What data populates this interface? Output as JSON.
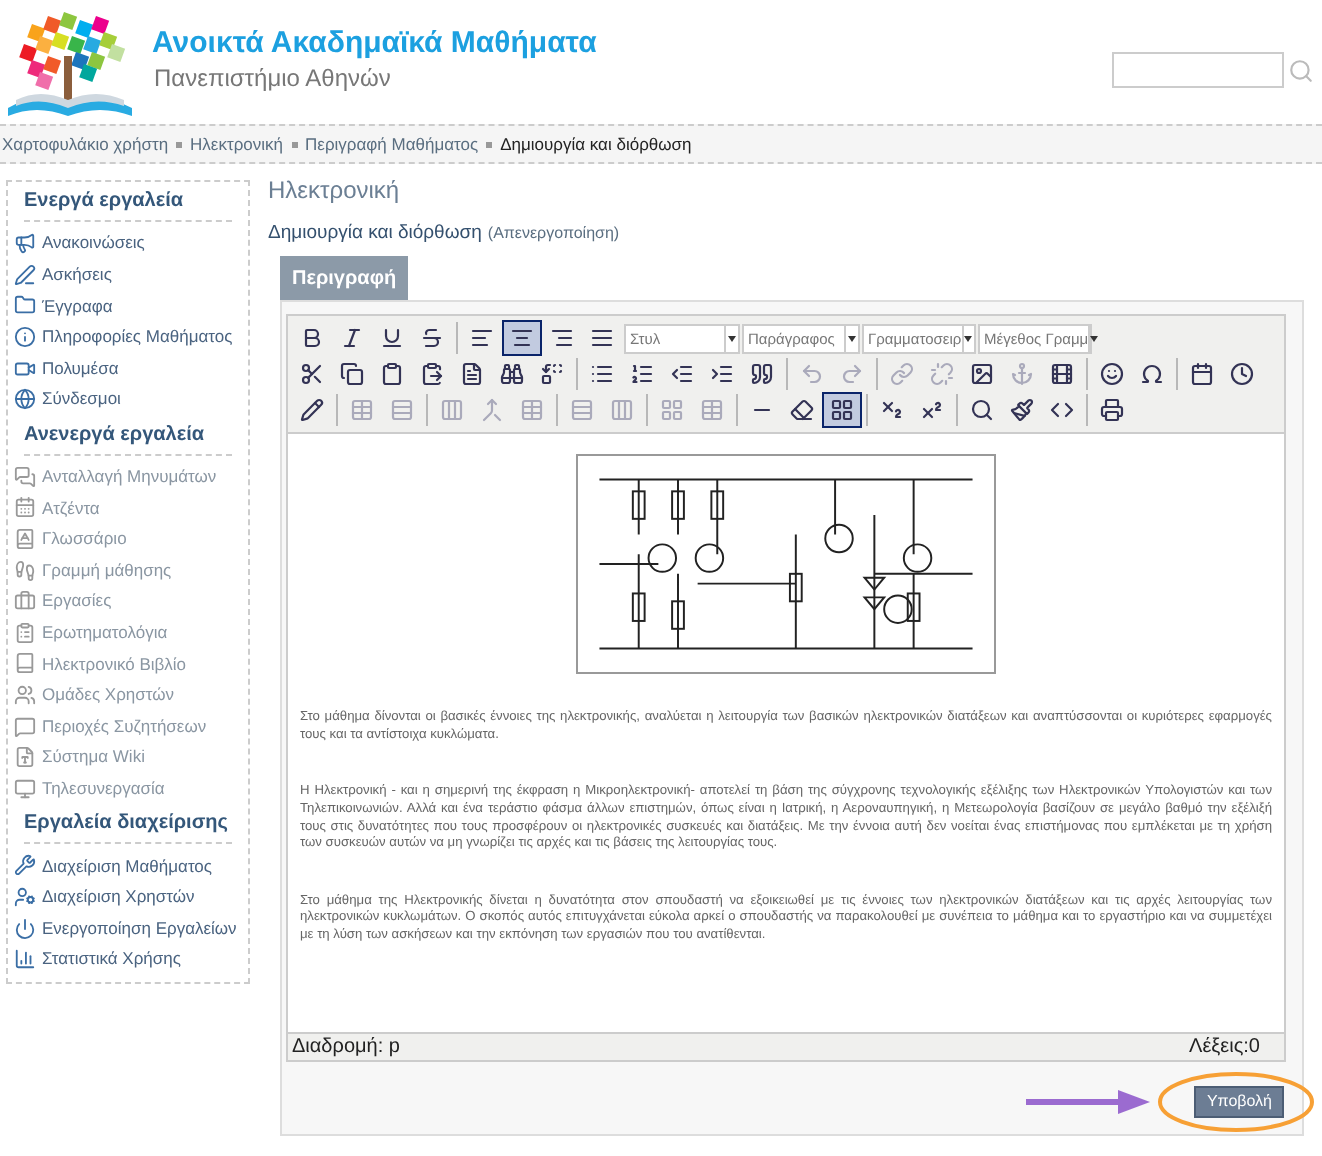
{
  "header": {
    "title": "Ανοικτά Ακαδημαϊκά Μαθήματα",
    "subtitle": "Πανεπιστήμιο Αθηνών"
  },
  "breadcrumb": [
    {
      "label": "Χαρτοφυλάκιο χρήστη",
      "current": false
    },
    {
      "label": "Ηλεκτρονική",
      "current": false
    },
    {
      "label": "Περιγραφή Μαθήματος",
      "current": false
    },
    {
      "label": "Δημιουργία και διόρθωση",
      "current": true
    }
  ],
  "sidebar": [
    {
      "title": "Ενεργά εργαλεία",
      "items": [
        {
          "label": "Ανακοινώσεις",
          "disabled": false
        },
        {
          "label": "Ασκήσεις",
          "disabled": false
        },
        {
          "label": "Έγγραφα",
          "disabled": false
        },
        {
          "label": "Πληροφορίες Μαθήματος",
          "disabled": false
        },
        {
          "label": "Πολυμέσα",
          "disabled": false
        },
        {
          "label": "Σύνδεσμοι",
          "disabled": false
        }
      ]
    },
    {
      "title": "Ανενεργά εργαλεία",
      "items": [
        {
          "label": "Ανταλλαγή Μηνυμάτων",
          "disabled": true
        },
        {
          "label": "Ατζέντα",
          "disabled": true
        },
        {
          "label": "Γλωσσάριο",
          "disabled": true
        },
        {
          "label": "Γραμμή μάθησης",
          "disabled": true
        },
        {
          "label": "Εργασίες",
          "disabled": true
        },
        {
          "label": "Ερωτηματολόγια",
          "disabled": true
        },
        {
          "label": "Ηλεκτρονικό Βιβλίο",
          "disabled": true
        },
        {
          "label": "Ομάδες Χρηστών",
          "disabled": true
        },
        {
          "label": "Περιοχές Συζητήσεων",
          "disabled": true
        },
        {
          "label": "Σύστημα Wiki",
          "disabled": true
        },
        {
          "label": "Τηλεσυνεργασία",
          "disabled": true
        }
      ]
    },
    {
      "title": "Εργαλεία διαχείρισης",
      "items": [
        {
          "label": "Διαχείριση Μαθήματος",
          "disabled": false
        },
        {
          "label": "Διαχείριση Χρηστών",
          "disabled": false
        },
        {
          "label": "Ενεργοποίηση Εργαλείων",
          "disabled": false
        },
        {
          "label": "Στατιστικά Χρήσης",
          "disabled": false
        }
      ]
    }
  ],
  "page_title": "Ηλεκτρονική",
  "subtitle": {
    "text": "Δημιουργία και διόρθωση",
    "link": "(Απενεργοποίηση)"
  },
  "tab": {
    "label": "Περιγραφή",
    "selected": true
  },
  "toolbar": {
    "row1_buttons": [
      {
        "selected": false
      },
      {
        "selected": false
      },
      {
        "selected": false
      },
      {
        "selected": false
      },
      {
        "selected": false
      },
      {
        "selected": true
      },
      {
        "selected": false
      },
      {
        "selected": false
      }
    ],
    "dropdowns": [
      {
        "value": "Στυλ"
      },
      {
        "value": "Παράγραφος"
      },
      {
        "value": "Γραμματοσειρ"
      },
      {
        "value": "Μέγεθος Γραμμ"
      }
    ],
    "row3_buttons": [
      {
        "selected": false
      },
      {
        "selected": false
      },
      {
        "selected": false
      },
      {
        "selected": false
      },
      {
        "selected": false
      },
      {
        "selected": false
      },
      {
        "selected": false
      },
      {
        "selected": false
      },
      {
        "selected": false
      },
      {
        "selected": false
      },
      {
        "selected": false
      },
      {
        "selected": false
      },
      {
        "selected": true
      },
      {
        "selected": false
      },
      {
        "selected": false
      },
      {
        "selected": false
      },
      {
        "selected": false
      },
      {
        "selected": false
      },
      {
        "selected": false
      }
    ]
  },
  "content": {
    "paragraphs": [
      "Στο μάθημα δίνονται οι βασικές έννοιες της ηλεκτρονικής, αναλύεται η λειτουργία των βασικών ηλεκτρονικών διατάξεων και αναπτύσσονται οι κυριότερες εφαρμογές τους και τα αντίστοιχα κυκλώματα.",
      "Η Ηλεκτρονική - και η σημερινή της έκφραση η Μικροηλεκτρονική- αποτελεί τη βάση της σύγχρονης τεχνολογικής εξέλιξης των Ηλεκτρονικών Υπολογιστών και των Τηλεπικοινωνιών. Αλλά και ένα τεράστιο φάσμα άλλων επιστημών, όπως είναι η Ιατρική, η Αεροναυπηγική, η Μετεωρολογία βασίζουν σε μεγάλο βαθμό την εξέλιξή τους στις δυνατότητες που τους προσφέρουν οι ηλεκτρονικές συσκευές και διατάξεις. Με την  έννοια αυτή δεν νοείται ένας επιστήμονας που εμπλέκεται με τη χρήση των συσκευών αυτών να μη γνωρίζει τις αρχές και τις βάσεις της λειτουργίας τους.",
      "Στο μάθημα της Ηλεκτρονικής δίνεται η δυνατότητα στον σπουδαστή να εξοικειωθεί με τις έννοιες των ηλεκτρονικών διατάξεων και τις αρχές λειτουργίας των ηλεκτρονικών κυκλωμάτων. Ο σκοπός αυτός επιτυγχάνεται εύκολα αρκεί ο σπουδαστής να παρακολουθεί με συνέπεια το μάθημα και το εργαστήριο και να συμμετέχει με τη λύση των ασκήσεων και την εκπόνηση των εργασιών που του ανατίθενται."
    ]
  },
  "status": {
    "path": "Διαδρομή: p",
    "words": "Λέξεις:0"
  },
  "submit": {
    "label": "Υποβολή",
    "highlighted": true
  }
}
